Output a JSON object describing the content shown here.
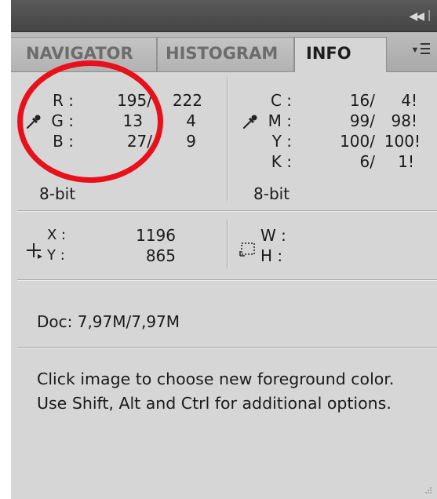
{
  "tabs": [
    {
      "label": "NAVIGATOR",
      "active": false
    },
    {
      "label": "HISTOGRAM",
      "active": false
    },
    {
      "label": "INFO",
      "active": true
    }
  ],
  "rgb": {
    "r_label": "R :",
    "g_label": "G :",
    "b_label": "B :",
    "r_val1": "195/",
    "r_val2": "222",
    "g_val1": "13",
    "g_val2": "4",
    "b_val1": "27/",
    "b_val2": "9",
    "bit_depth": "8-bit"
  },
  "cmyk": {
    "c_label": "C :",
    "m_label": "M :",
    "y_label": "Y :",
    "k_label": "K :",
    "c_val1": "16/",
    "c_val2": "4!",
    "m_val1": "99/",
    "m_val2": "98!",
    "y_val1": "100/",
    "y_val2": "100!",
    "k_val1": "6/",
    "k_val2": "1!",
    "bit_depth": "8-bit"
  },
  "position": {
    "x_label": "X :",
    "y_label": "Y :",
    "x_val": "1196",
    "y_val": "865"
  },
  "size": {
    "w_label": "W :",
    "h_label": "H :"
  },
  "doc": "Doc: 7,97M/7,97M",
  "hint": "Click image to choose new foreground color.  Use Shift, Alt and Ctrl for additional options.",
  "colors": {
    "annotation": "#e8101a",
    "panel_bg": "#d6d6d6",
    "titlebar": "#4a4a4a"
  },
  "icons": [
    "collapse-icon",
    "panel-menu-icon",
    "eyedropper-icon",
    "crosshair-icon",
    "marquee-icon",
    "resize-grip-icon"
  ]
}
